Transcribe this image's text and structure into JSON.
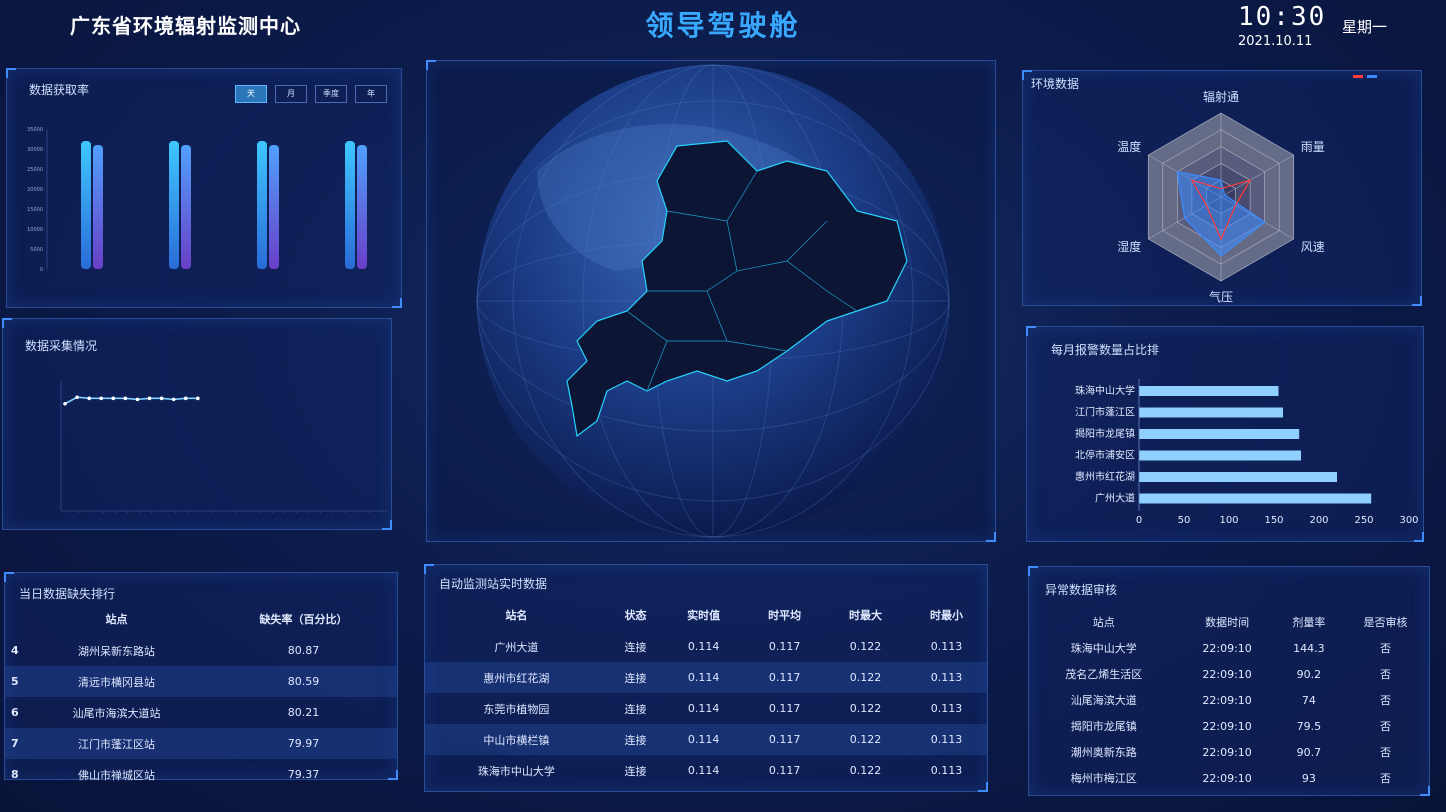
{
  "header": {
    "org_title": "广东省环境辐射监测中心",
    "main_title": "领导驾驶舱",
    "time": "10:30",
    "date": "2021.10.11",
    "weekday": "星期一"
  },
  "colors": {
    "accent": "#39a8ff",
    "bar_cyan": "#3aa6ff",
    "bar_purple": "#6a4fd8",
    "hbar": "#8fd0ff"
  },
  "acquisition": {
    "title": "数据获取率",
    "tabs": [
      "天",
      "月",
      "季度",
      "年"
    ],
    "active_tab": 0,
    "y_ticks": [
      "35000",
      "30000",
      "25000",
      "20000",
      "15000",
      "10000",
      "5000",
      "0"
    ],
    "bars": [
      {
        "a": 32000,
        "b": 31000
      },
      {
        "a": 32000,
        "b": 31000
      },
      {
        "a": 32000,
        "b": 31000
      },
      {
        "a": 32000,
        "b": 31000
      }
    ],
    "ymax": 35000
  },
  "collection": {
    "title": "数据采集情况",
    "values": [
      4950,
      5250,
      5200,
      5200,
      5200,
      5200,
      5150,
      5200,
      5200,
      5150,
      5200,
      5200
    ],
    "ymax": 6000,
    "x_count": 27
  },
  "env": {
    "title": "环境数据",
    "axes": [
      "辐射通",
      "雨量",
      "风速",
      "气压",
      "湿度",
      "温度"
    ],
    "series": [
      [
        0.2,
        0.05,
        0.6,
        0.7,
        0.5,
        0.6
      ],
      [
        0.1,
        0.4,
        0.2,
        0.5,
        0.2,
        0.4
      ]
    ]
  },
  "alarms": {
    "title": "每月报警数量占比排",
    "categories": [
      "珠海中山大学",
      "江门市蓬江区",
      "揭阳市龙尾镇",
      "北停市浦安区",
      "惠州市红花湖",
      "广州大道"
    ],
    "values": [
      155,
      160,
      178,
      180,
      220,
      258
    ],
    "ticks": [
      "0",
      "50",
      "100",
      "150",
      "200",
      "250",
      "300"
    ],
    "xmax": 300
  },
  "missing": {
    "title": "当日数据缺失排行",
    "columns": [
      "站点",
      "缺失率（百分比）"
    ],
    "rows": [
      {
        "rank": "4",
        "site": "湖州呆新东路站",
        "rate": "80.87"
      },
      {
        "rank": "5",
        "site": "清远市横冈县站",
        "rate": "80.59"
      },
      {
        "rank": "6",
        "site": "汕尾市海滨大道站",
        "rate": "80.21"
      },
      {
        "rank": "7",
        "site": "江门市蓬江区站",
        "rate": "79.97"
      },
      {
        "rank": "8",
        "site": "佛山市禅城区站",
        "rate": "79.37"
      }
    ]
  },
  "realtime": {
    "title": "自动监测站实时数据",
    "columns": [
      "站名",
      "状态",
      "实时值",
      "时平均",
      "时最大",
      "时最小"
    ],
    "rows": [
      [
        "广州大道",
        "连接",
        "0.114",
        "0.117",
        "0.122",
        "0.113"
      ],
      [
        "惠州市红花湖",
        "连接",
        "0.114",
        "0.117",
        "0.122",
        "0.113"
      ],
      [
        "东莞市植物园",
        "连接",
        "0.114",
        "0.117",
        "0.122",
        "0.113"
      ],
      [
        "中山市横栏镇",
        "连接",
        "0.114",
        "0.117",
        "0.122",
        "0.113"
      ],
      [
        "珠海市中山大学",
        "连接",
        "0.114",
        "0.117",
        "0.122",
        "0.113"
      ]
    ]
  },
  "audit": {
    "title": "异常数据审核",
    "columns": [
      "站点",
      "数据时间",
      "剂量率",
      "是否审核"
    ],
    "rows": [
      [
        "珠海中山大学",
        "22:09:10",
        "144.3",
        "否"
      ],
      [
        "茂名乙烯生活区",
        "22:09:10",
        "90.2",
        "否"
      ],
      [
        "汕尾海滨大道",
        "22:09:10",
        "74",
        "否"
      ],
      [
        "揭阳市龙尾镇",
        "22:09:10",
        "79.5",
        "否"
      ],
      [
        "潮州奥新东路",
        "22:09:10",
        "90.7",
        "否"
      ],
      [
        "梅州市梅江区",
        "22:09:10",
        "93",
        "否"
      ]
    ]
  }
}
